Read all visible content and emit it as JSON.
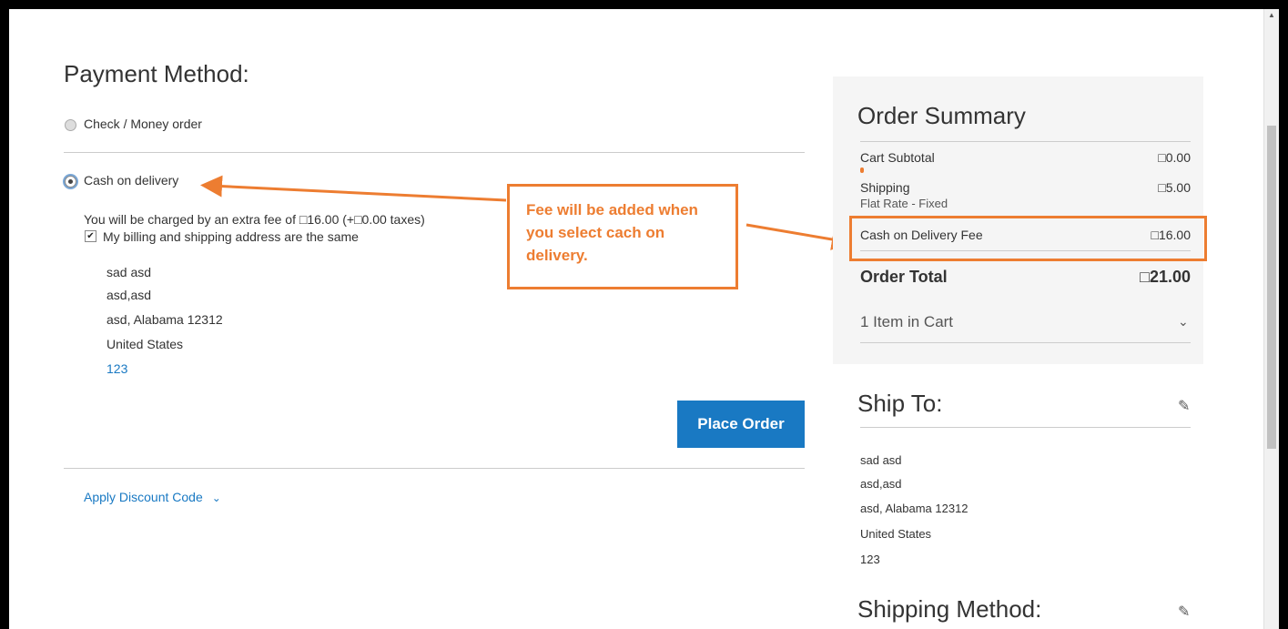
{
  "payment": {
    "title": "Payment Method:",
    "option_check": "Check / Money order",
    "option_cod": "Cash on delivery",
    "fee_note": "You will be charged by an extra fee of □16.00 (+□0.00 taxes)",
    "same_address": "My billing and shipping address are the same",
    "address": [
      "sad asd",
      "asd,asd",
      "asd, Alabama 12312",
      "United States"
    ],
    "phone": "123",
    "place_order": "Place Order",
    "discount": "Apply Discount Code"
  },
  "callout": {
    "line1": "Fee will be added when",
    "line2": "you select cach on",
    "line3": "delivery."
  },
  "summary": {
    "title": "Order Summary",
    "subtotal_label": "Cart Subtotal",
    "subtotal_value": "□0.00",
    "shipping_label": "Shipping",
    "shipping_method": "Flat Rate - Fixed",
    "shipping_value": "□5.00",
    "fee_label": "Cash on Delivery Fee",
    "fee_value": "□16.00",
    "total_label": "Order Total",
    "total_value": "□21.00",
    "items": "1 Item in Cart"
  },
  "ship_to": {
    "title": "Ship To:",
    "address": [
      "sad asd",
      "asd,asd",
      "asd, Alabama 12312",
      "United States"
    ],
    "phone": "123"
  },
  "shipping_method": {
    "title": "Shipping Method:"
  },
  "colors": {
    "accent": "#1979c3",
    "callout": "#ed7d31"
  }
}
